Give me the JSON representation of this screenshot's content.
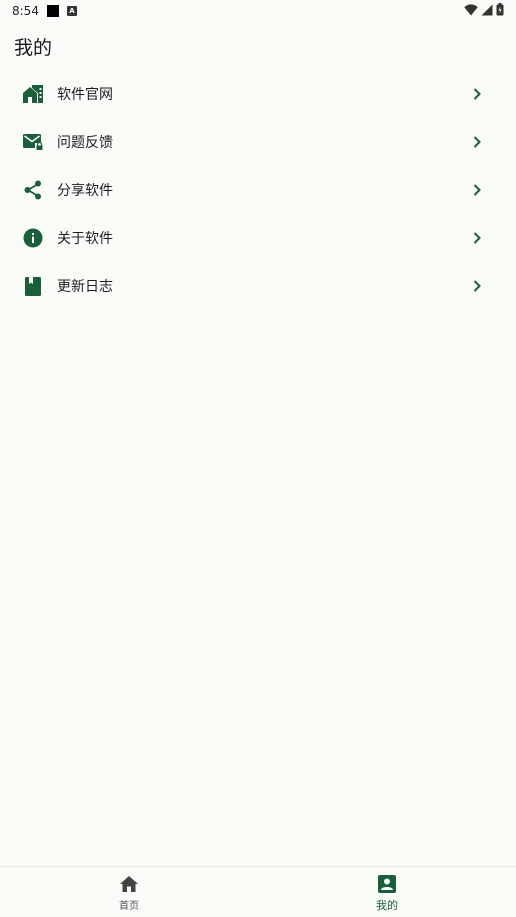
{
  "status_bar": {
    "time": "8:54",
    "notification_a": "A"
  },
  "page": {
    "title": "我的"
  },
  "menu": {
    "items": [
      {
        "label": "软件官网",
        "icon": "website-icon"
      },
      {
        "label": "问题反馈",
        "icon": "feedback-mail-icon"
      },
      {
        "label": "分享软件",
        "icon": "share-icon"
      },
      {
        "label": "关于软件",
        "icon": "info-icon"
      },
      {
        "label": "更新日志",
        "icon": "book-icon"
      }
    ]
  },
  "bottom_nav": {
    "items": [
      {
        "label": "首页",
        "icon": "home-icon",
        "active": false
      },
      {
        "label": "我的",
        "icon": "profile-icon",
        "active": true
      }
    ]
  },
  "colors": {
    "accent": "#1b5e3b",
    "background": "#fafcf8",
    "inactive": "#555555"
  }
}
